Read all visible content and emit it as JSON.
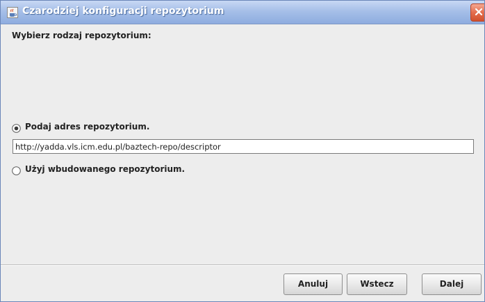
{
  "window": {
    "title": "Czarodziej konfiguracji repozytorium"
  },
  "content": {
    "heading": "Wybierz rodzaj repozytorium:",
    "options": [
      {
        "label": "Podaj adres repozytorium.",
        "selected": true
      },
      {
        "label": "Użyj wbudowanego repozytorium.",
        "selected": false
      }
    ],
    "url_value": "http://yadda.vls.icm.edu.pl/baztech-repo/descriptor"
  },
  "buttons": {
    "cancel": "Anuluj",
    "back": "Wstecz",
    "next": "Dalej"
  },
  "icons": {
    "app": "java-cup-icon",
    "close": "close-icon"
  },
  "colors": {
    "titlebar": "#a6bfe8",
    "close": "#e46d4e",
    "background": "#ededed"
  }
}
